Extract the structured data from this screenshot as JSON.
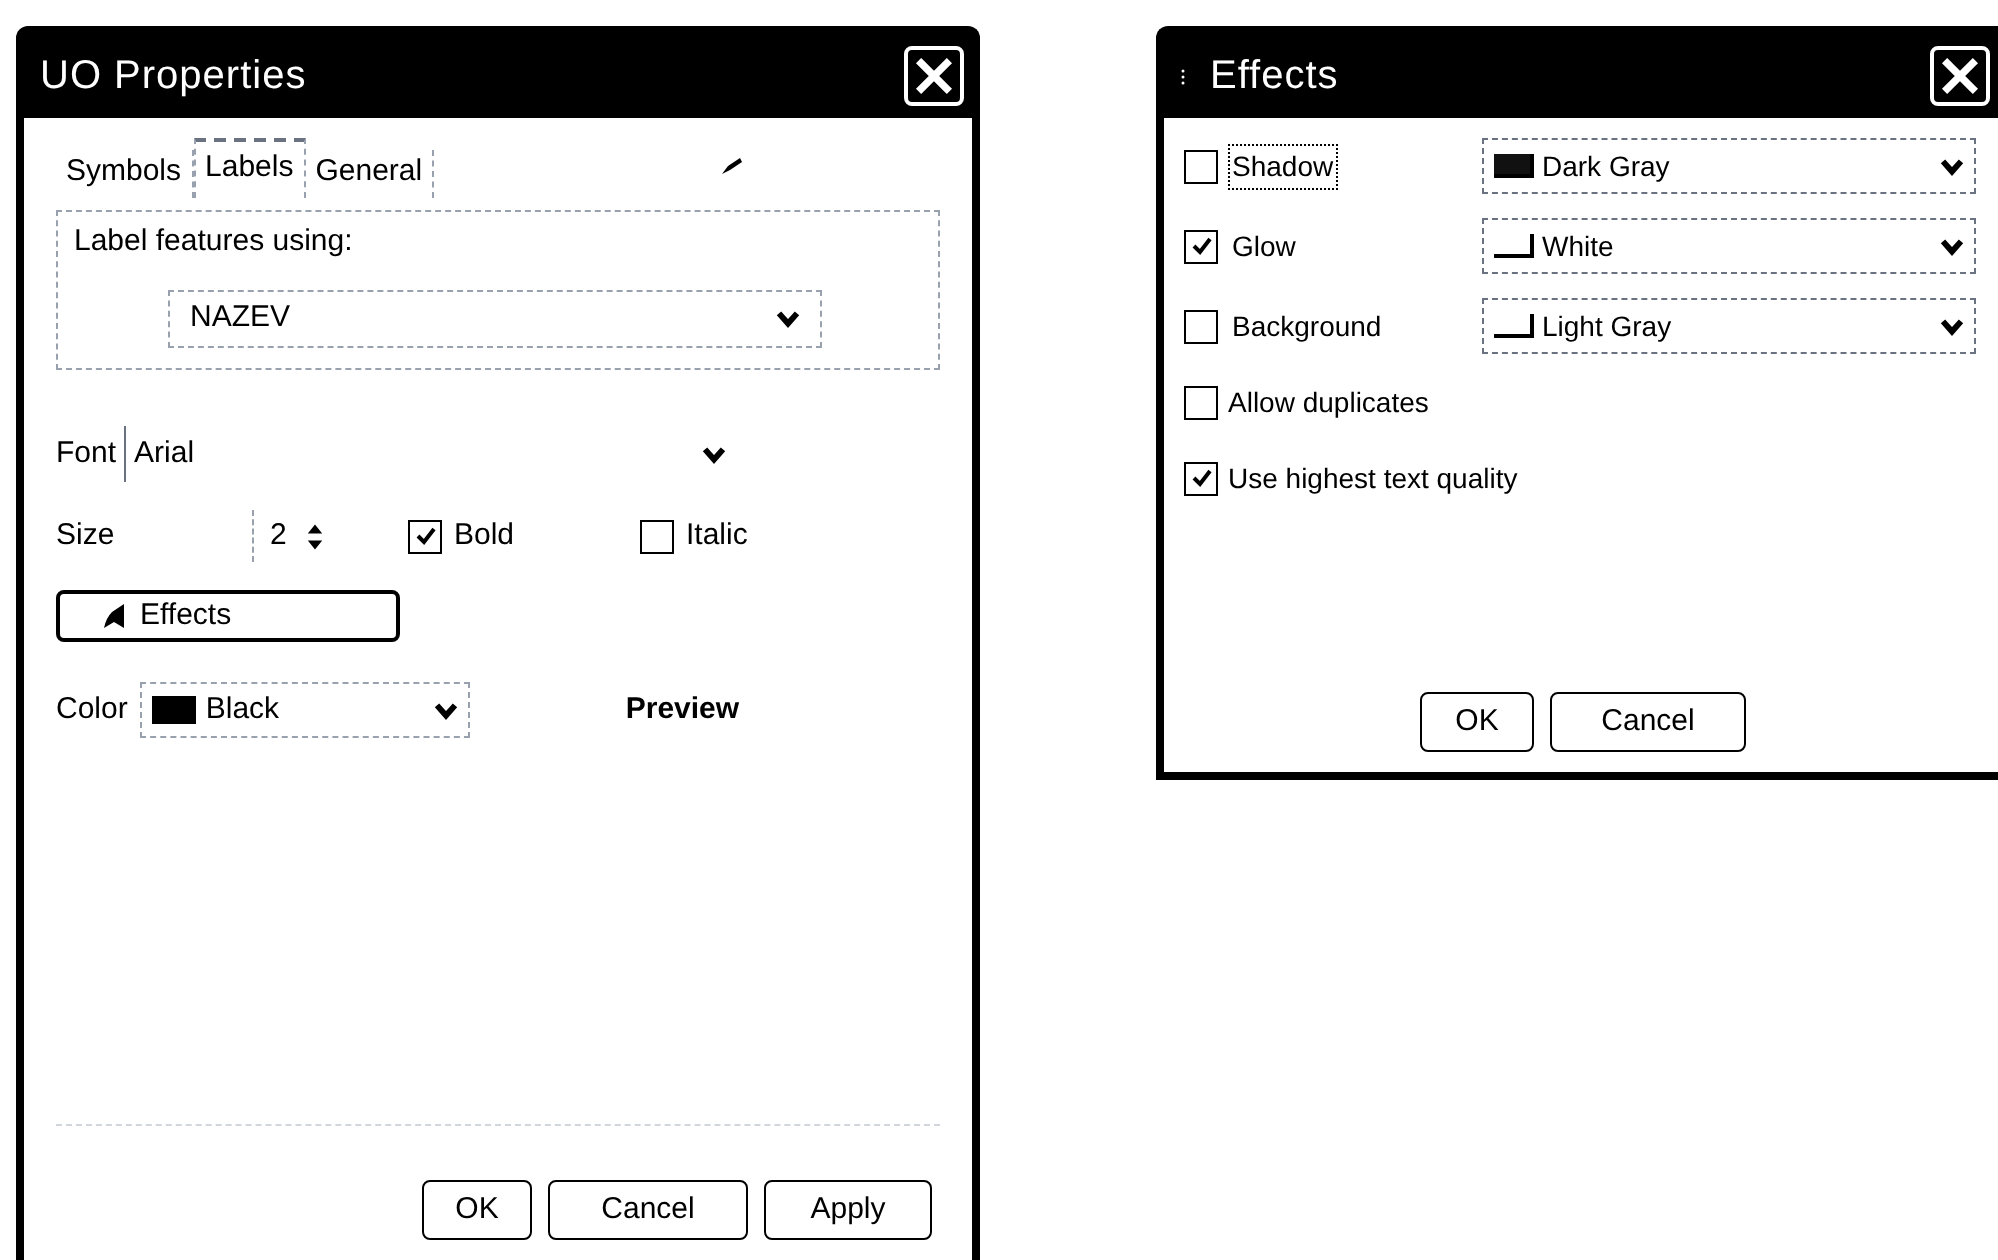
{
  "properties_dialog": {
    "title": "UO Properties",
    "tabs": [
      {
        "label": "Symbols",
        "selected": false
      },
      {
        "label": "Labels",
        "selected": true
      },
      {
        "label": "General",
        "selected": false
      }
    ],
    "group": {
      "legend": "Label features using:",
      "field": {
        "value": "NAZEV"
      }
    },
    "font": {
      "label": "Font",
      "value": "Arial"
    },
    "size": {
      "label": "Size",
      "value": "2"
    },
    "styles": [
      {
        "label": "Bold",
        "checked": true
      },
      {
        "label": "Italic",
        "checked": false
      }
    ],
    "effects_button": "Effects",
    "color": {
      "label": "Color",
      "value": "Black"
    },
    "preview": "Preview",
    "buttons": [
      "OK",
      "Cancel",
      "Apply"
    ]
  },
  "effects_dialog": {
    "title": "Effects",
    "effects": [
      {
        "label": "Shadow",
        "checked": false,
        "focused": true,
        "color": "#111111",
        "color_name": "Dark Gray"
      },
      {
        "label": "Glow",
        "checked": true,
        "focused": false,
        "color": "#ffffff",
        "color_name": "White"
      },
      {
        "label": "Background",
        "checked": false,
        "focused": false,
        "color": "#ffffff",
        "color_name": "Light Gray"
      }
    ],
    "options": [
      {
        "label": "Allow duplicates",
        "checked": false
      },
      {
        "label": "Use highest text quality",
        "checked": true
      }
    ],
    "buttons": [
      "OK",
      "Cancel"
    ]
  }
}
